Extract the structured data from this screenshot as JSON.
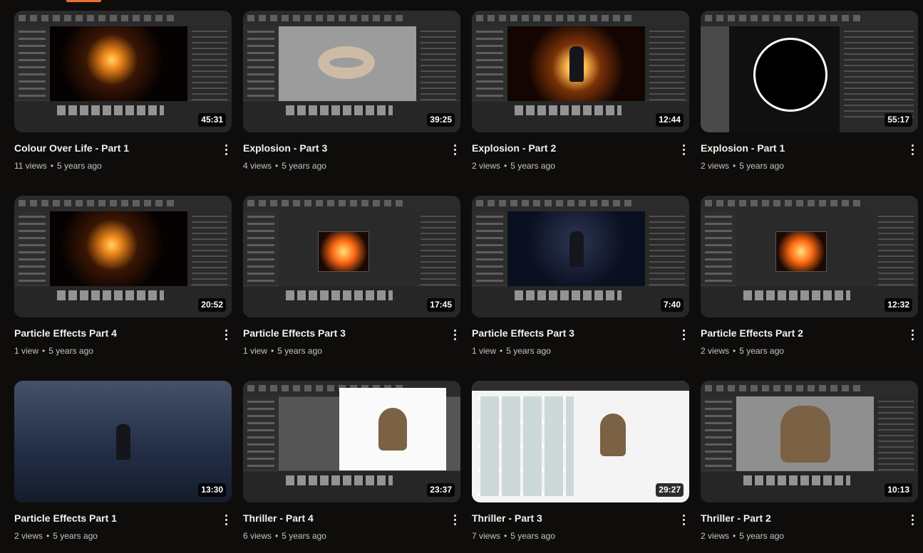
{
  "videos": [
    {
      "title": "Colour Over Life - Part 1",
      "views": "11 views",
      "age": "5 years ago",
      "duration": "45:31",
      "thumb": "fire"
    },
    {
      "title": "Explosion - Part 3",
      "views": "4 views",
      "age": "5 years ago",
      "duration": "39:25",
      "thumb": "grey"
    },
    {
      "title": "Explosion - Part 2",
      "views": "2 views",
      "age": "5 years ago",
      "duration": "12:44",
      "thumb": "sun"
    },
    {
      "title": "Explosion - Part 1",
      "views": "2 views",
      "age": "5 years ago",
      "duration": "55:17",
      "thumb": "ring"
    },
    {
      "title": "Particle Effects Part 4",
      "views": "1 view",
      "age": "5 years ago",
      "duration": "20:52",
      "thumb": "fire"
    },
    {
      "title": "Particle Effects Part 3",
      "views": "1 view",
      "age": "5 years ago",
      "duration": "17:45",
      "thumb": "sparks"
    },
    {
      "title": "Particle Effects Part 3",
      "views": "1 view",
      "age": "5 years ago",
      "duration": "7:40",
      "thumb": "night"
    },
    {
      "title": "Particle Effects Part 2",
      "views": "2 views",
      "age": "5 years ago",
      "duration": "12:32",
      "thumb": "sparks"
    },
    {
      "title": "Particle Effects Part 1",
      "views": "2 views",
      "age": "5 years ago",
      "duration": "13:30",
      "thumb": "storm"
    },
    {
      "title": "Thriller - Part 4",
      "views": "6 views",
      "age": "5 years ago",
      "duration": "23:37",
      "thumb": "white"
    },
    {
      "title": "Thriller - Part 3",
      "views": "7 views",
      "age": "5 years ago",
      "duration": "29:27",
      "thumb": "mixamo"
    },
    {
      "title": "Thriller - Part 2",
      "views": "2 views",
      "age": "5 years ago",
      "duration": "10:13",
      "thumb": "character"
    }
  ],
  "separator": "•",
  "colors": {
    "background": "#0f0d0b",
    "accent": "#e8722c",
    "title": "#f1f1f1",
    "meta": "#c4c4c4"
  }
}
